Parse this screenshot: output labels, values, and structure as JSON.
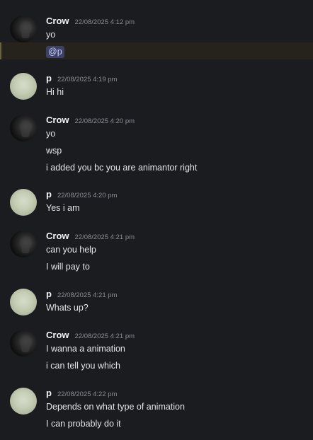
{
  "messages": [
    {
      "author": "Crow",
      "time": "22/08/2025 4:12 pm",
      "lines": [
        "yo"
      ],
      "mention": "@p"
    },
    {
      "author": "p",
      "time": "22/08/2025 4:19 pm",
      "lines": [
        "Hi hi"
      ]
    },
    {
      "author": "Crow",
      "time": "22/08/2025 4:20 pm",
      "lines": [
        "yo",
        "wsp",
        "i added you bc you are animantor right"
      ]
    },
    {
      "author": "p",
      "time": "22/08/2025 4:20 pm",
      "lines": [
        "Yes i am"
      ]
    },
    {
      "author": "Crow",
      "time": "22/08/2025 4:21 pm",
      "lines": [
        "can you help",
        "I will pay to"
      ]
    },
    {
      "author": "p",
      "time": "22/08/2025 4:21 pm",
      "lines": [
        "Whats up?"
      ]
    },
    {
      "author": "Crow",
      "time": "22/08/2025 4:21 pm",
      "lines": [
        "I wanna a animation",
        "i can tell you which"
      ]
    },
    {
      "author": "p",
      "time": "22/08/2025 4:22 pm",
      "lines": [
        "Depends on what type of animation",
        "I can probably do it"
      ]
    }
  ]
}
